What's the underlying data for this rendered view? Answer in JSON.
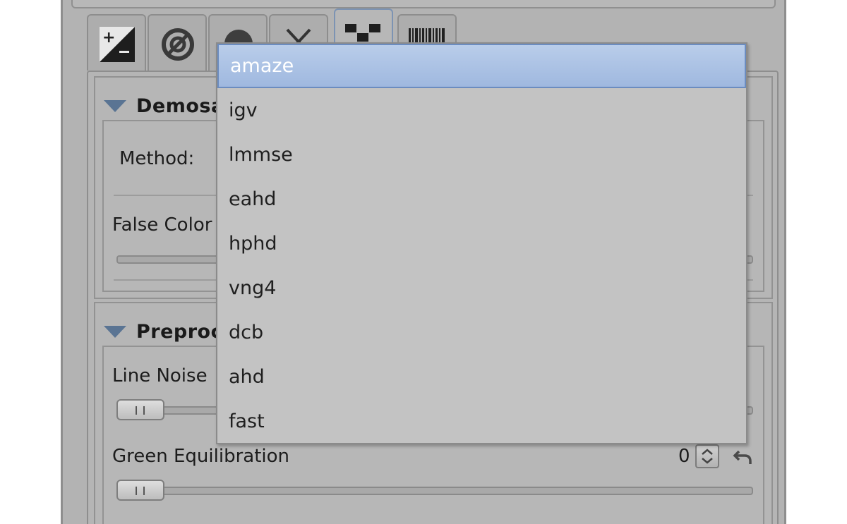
{
  "tabs": [
    {
      "name": "exposure",
      "icon": "exposure-icon"
    },
    {
      "name": "detail",
      "icon": "detail-icon"
    },
    {
      "name": "color",
      "icon": "color-icon"
    },
    {
      "name": "transform",
      "icon": "transform-icon"
    },
    {
      "name": "raw",
      "icon": "raw-icon",
      "active": true
    },
    {
      "name": "metadata",
      "icon": "barcode-icon"
    }
  ],
  "demosaicing": {
    "title": "Demosa",
    "method_label": "Method:",
    "false_color_label": "False Color"
  },
  "preprocessing": {
    "title": "Preproc",
    "line_noise_label": "Line Noise",
    "green_equil_label": "Green Equilibration",
    "green_equil_value": "0"
  },
  "dropdown": {
    "selected": "amaze",
    "options": [
      "amaze",
      "igv",
      "lmmse",
      "eahd",
      "hphd",
      "vng4",
      "dcb",
      "ahd",
      "fast"
    ]
  },
  "colors": {
    "panel_bg": "#b3b3b3",
    "dropdown_bg": "#c3c3c3",
    "selection": "#a8bfe3",
    "accent": "#5a7493"
  }
}
